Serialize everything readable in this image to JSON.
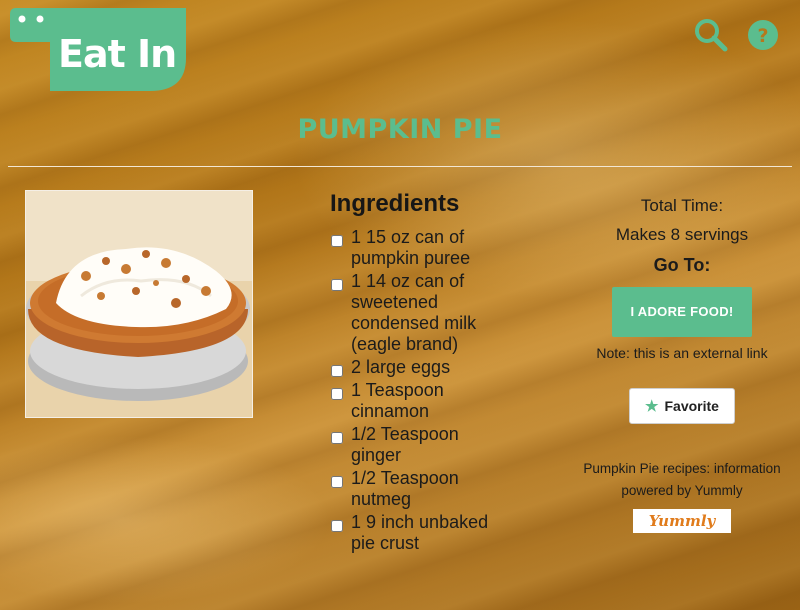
{
  "header": {
    "logo_text": "Eat In",
    "search_icon": "search-icon",
    "help_icon": "help-icon",
    "accent_color": "#5bbd8e"
  },
  "recipe": {
    "title": "PUMPKIN PIE",
    "image": "pumpkin-pie-photo",
    "ingredients_heading": "Ingredients",
    "ingredients": [
      "1 15 oz can of pumpkin puree",
      "1 14 oz can of sweetened condensed milk (eagle brand)",
      "2 large eggs",
      "1 Teaspoon cinnamon",
      "1/2 Teaspoon ginger",
      "1/2 Teaspoon nutmeg",
      "1 9 inch unbaked pie crust"
    ]
  },
  "side": {
    "total_time": "Total Time:",
    "servings": "Makes 8 servings",
    "goto_label": "Go To:",
    "source_button": "I ADORE FOOD!",
    "note": "Note: this is an external link",
    "favorite_label": "Favorite",
    "powered_by": "Pumpkin Pie recipes: information powered by Yummly",
    "yummly_logo": "Yummly"
  }
}
